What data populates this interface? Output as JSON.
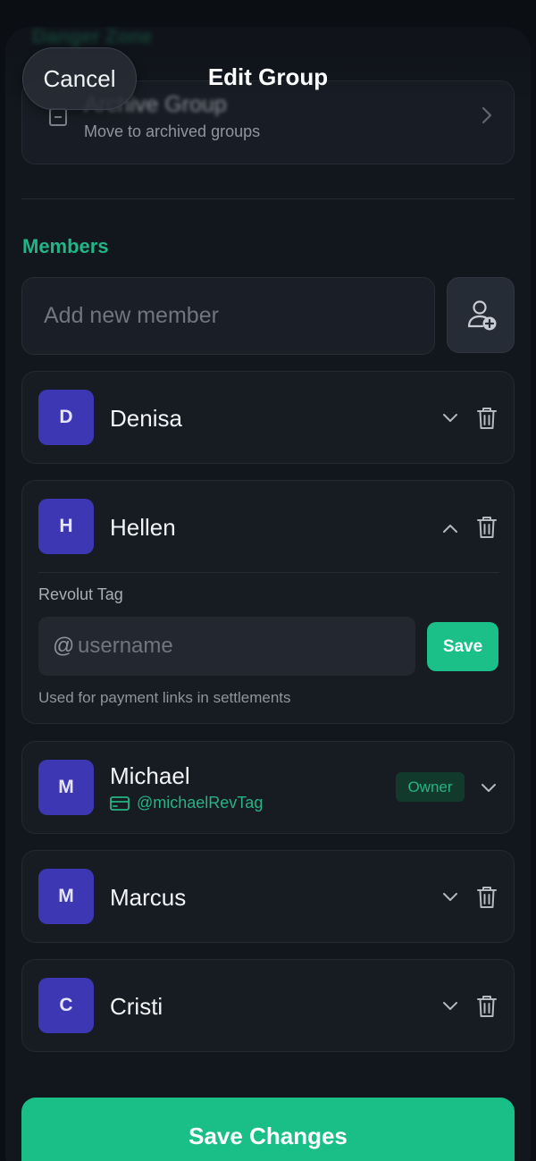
{
  "nav": {
    "cancel_label": "Cancel",
    "title": "Edit Group"
  },
  "danger_zone": {
    "label": "Danger Zone",
    "archive_title": "Archive Group",
    "archive_subtitle": "Move to archived groups"
  },
  "members_section": {
    "label": "Members",
    "add_placeholder": "Add new member"
  },
  "members": [
    {
      "initial": "D",
      "name": "Denisa",
      "expanded": false
    },
    {
      "initial": "H",
      "name": "Hellen",
      "expanded": true,
      "revolut_label": "Revolut Tag",
      "at_symbol": "@",
      "username_placeholder": "username",
      "save_label": "Save",
      "help_text": "Used for payment links in settlements"
    },
    {
      "initial": "M",
      "name": "Michael",
      "expanded": false,
      "badge": "Owner",
      "tag": "@michaelRevTag"
    },
    {
      "initial": "M",
      "name": "Marcus",
      "expanded": false
    },
    {
      "initial": "C",
      "name": "Cristi",
      "expanded": false
    }
  ],
  "footer": {
    "save_changes_label": "Save Changes"
  },
  "colors": {
    "accent": "#1abf88",
    "avatar": "#3d37b3",
    "card": "#171b22",
    "background": "#0b0e13"
  }
}
